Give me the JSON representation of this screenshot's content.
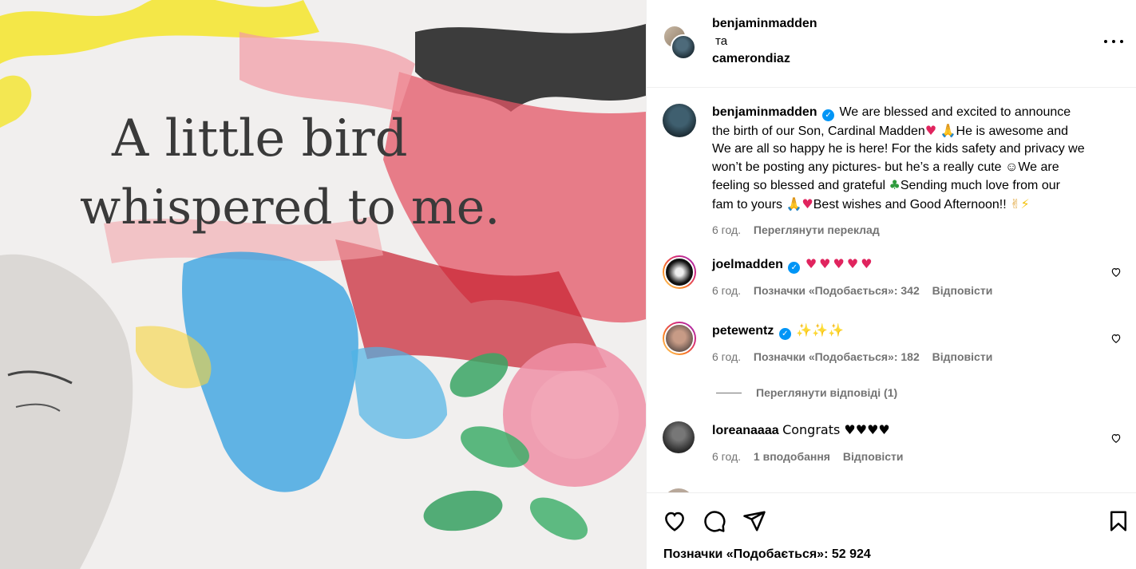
{
  "header": {
    "user1": "benjaminmadden",
    "conjunction": "та",
    "user2": "camerondiaz"
  },
  "artwork": {
    "line1": "A little bird",
    "line2": "whispered to me."
  },
  "caption": {
    "username": "benjaminmadden",
    "text1": "We are blessed and excited to announce",
    "text2": "the birth of our Son, Cardinal Madden",
    "text3": "He is awesome and",
    "text4": "We are all so happy he is here! For the kids safety and privacy we",
    "text5": "won’t be posting any pictures- but he’s a really cute ☺We are",
    "text6": "feeling so blessed and grateful",
    "text7": "Sending much love from our",
    "text8": "fam to yours",
    "text9": "Best wishes and Good Afternoon!!",
    "time": "6 год.",
    "translate": "Переглянути переклад"
  },
  "comments": [
    {
      "username": "joelmadden",
      "text": "♥♥♥♥♥",
      "time": "6 год.",
      "likes": "Позначки «Подобається»: 342",
      "reply": "Відповісти"
    },
    {
      "username": "petewentz",
      "text": "✨✨✨",
      "time": "6 год.",
      "likes": "Позначки «Подобається»: 182",
      "reply": "Відповісти"
    },
    {
      "username": "loreanaaaa",
      "text": "Congrats ♥♥♥♥",
      "time": "6 год.",
      "likes": "1 вподобання",
      "reply": "Відповісти"
    }
  ],
  "view_replies": "Переглянути відповіді (1)",
  "likes_total": "Позначки «Подобається»: 52 924",
  "colors": {
    "verified": "#0095f6",
    "heart": "#e0245e",
    "secondary": "#737373"
  },
  "icons": [
    "more-options-icon",
    "like-icon",
    "comment-icon",
    "share-icon",
    "bookmark-icon",
    "verified-icon"
  ]
}
